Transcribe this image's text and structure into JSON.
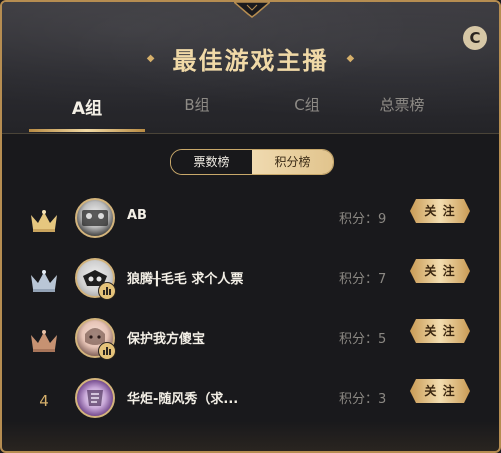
{
  "header": {
    "title": "最佳游戏主播",
    "close_icon": "coin-c-icon"
  },
  "tabs": [
    {
      "label": "A组",
      "active": true
    },
    {
      "label": "B组",
      "active": false
    },
    {
      "label": "C组",
      "active": false
    },
    {
      "label": "总票榜",
      "active": false
    }
  ],
  "switch": {
    "options": [
      {
        "label": "票数榜",
        "active": false
      },
      {
        "label": "积分榜",
        "active": true
      }
    ]
  },
  "rows": [
    {
      "rank": "1",
      "rank_icon": "gold-crown-icon",
      "name": "AB",
      "score_label": "积分：9",
      "follow_label": "关 注",
      "has_badge": false
    },
    {
      "rank": "2",
      "rank_icon": "silver-crown-icon",
      "name": "狼腾╂毛毛 求个人票",
      "score_label": "积分：7",
      "follow_label": "关 注",
      "has_badge": true
    },
    {
      "rank": "3",
      "rank_icon": "bronze-crown-icon",
      "name": "保护我方傻宝",
      "score_label": "积分：5",
      "follow_label": "关 注",
      "has_badge": true
    },
    {
      "rank": "4",
      "rank_icon": "",
      "name": "华炬-随风秀（求...",
      "score_label": "积分：3",
      "follow_label": "关 注",
      "has_badge": false
    }
  ],
  "colors": {
    "gold": "#e6c77f",
    "silver": "#b9c6d6",
    "bronze": "#c79272",
    "accent": "#d6b06b"
  }
}
